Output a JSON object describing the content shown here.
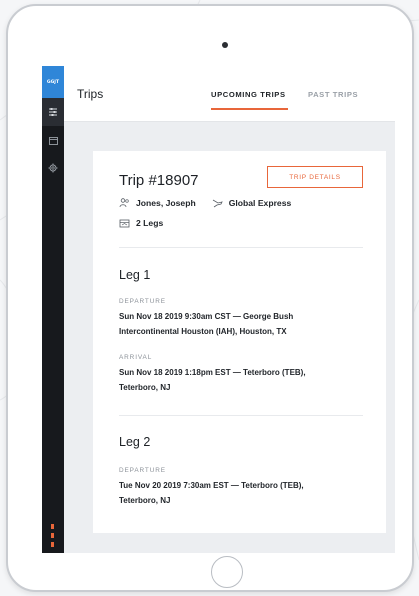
{
  "sidebar": {
    "logo_text": "GGJT",
    "icons": [
      "sliders-icon",
      "calendar-icon",
      "gear-icon"
    ],
    "accent_color": "#e8663a",
    "logo_color": "#2f86d8"
  },
  "header": {
    "title": "Trips",
    "tabs": [
      {
        "label": "UPCOMING TRIPS",
        "active": true
      },
      {
        "label": "PAST TRIPS",
        "active": false
      }
    ]
  },
  "trip": {
    "title": "Trip #18907",
    "details_button": "TRIP DETAILS",
    "passenger": "Jones, Joseph",
    "aircraft": "Global Express",
    "legs_count": "2 Legs",
    "legs": [
      {
        "title": "Leg 1",
        "departure_label": "DEPARTURE",
        "departure_line1": "Sun Nov 18 2019   9:30am CST   —   George Bush",
        "departure_line2": "Intercontinental Houston (IAH), Houston, TX",
        "arrival_label": "ARRIVAL",
        "arrival_line1": "Sun Nov 18 2019   1:18pm EST   —   Teterboro (TEB),",
        "arrival_line2": "Teterboro, NJ"
      },
      {
        "title": "Leg 2",
        "departure_label": "DEPARTURE",
        "departure_line1": "Tue Nov 20 2019   7:30am EST   —   Teterboro (TEB),",
        "departure_line2": "Teterboro, NJ"
      }
    ]
  }
}
